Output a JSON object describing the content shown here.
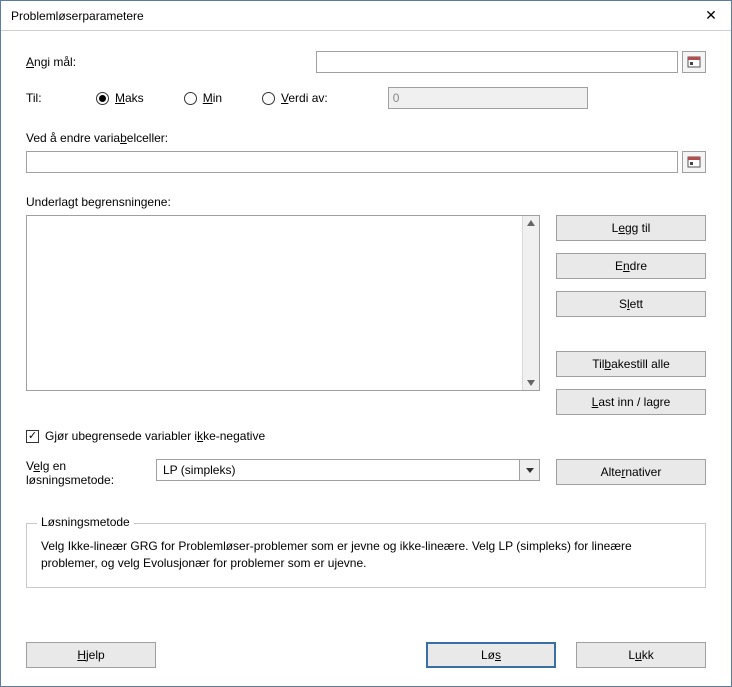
{
  "title": "Problemløserparametere",
  "labels": {
    "set_objective_pre": "",
    "set_objective_u": "A",
    "set_objective_post": "ngi mål:",
    "to": "Til:",
    "max_u": "M",
    "max_post": "aks",
    "min_u": "M",
    "min_post": "in",
    "valueof_u": "V",
    "valueof_post": "erdi av:",
    "valueof_value": "0",
    "by_changing_pre": "Ved å endre varia",
    "by_changing_u": "b",
    "by_changing_post": "elceller:",
    "constraints": "Underlagt begrensningene:",
    "add_pre": "L",
    "add_u": "e",
    "add_post": "gg til",
    "change_pre": "E",
    "change_u": "n",
    "change_post": "dre",
    "delete_pre": "S",
    "delete_u": "l",
    "delete_post": "ett",
    "resetall_pre": "Til",
    "resetall_u": "b",
    "resetall_post": "akestill alle",
    "loadsave_u": "L",
    "loadsave_post": "ast inn / lagre",
    "nonneg_pre": "Gjør ubegrensede variabler i",
    "nonneg_u": "k",
    "nonneg_post": "ke-negative",
    "select_method_pre": "V",
    "select_method_u": "e",
    "select_method_post": "lg en",
    "select_method_line2": "løsningsmetode:",
    "method_value": "LP (simpleks)",
    "options_pre": "Alte",
    "options_u": "r",
    "options_post": "nativer",
    "group_title": "Løsningsmetode",
    "group_desc": "Velg Ikke-lineær GRG for Problemløser-problemer som er jevne og ikke-lineære. Velg LP (simpleks) for lineære problemer, og velg Evolusjonær for problemer som er ujevne.",
    "help_u": "H",
    "help_post": "jelp",
    "solve_pre": "Lø",
    "solve_u": "s",
    "close_pre": "L",
    "close_u": "u",
    "close_post": "kk"
  }
}
